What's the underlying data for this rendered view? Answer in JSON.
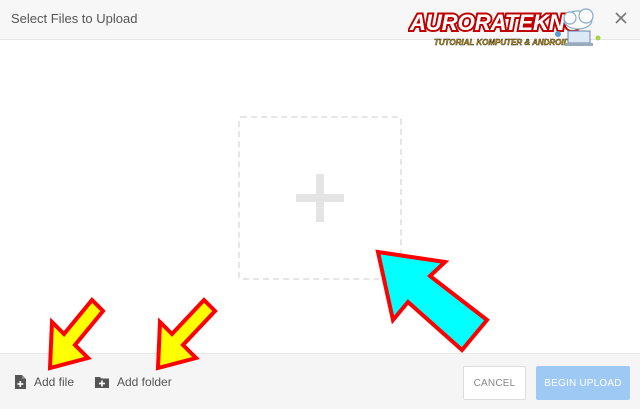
{
  "dialog": {
    "title": "Select Files to Upload"
  },
  "watermark": {
    "brand": "AURORATEKNO",
    "tagline": "TUTORIAL KOMPUTER & ANDROID"
  },
  "footer": {
    "add_file_label": "Add file",
    "add_folder_label": "Add folder",
    "cancel_label": "CANCEL",
    "begin_upload_label": "BEGIN UPLOAD"
  },
  "colors": {
    "primary_disabled": "#9ec9f5",
    "header_bg": "#f7f7f7",
    "footer_bg": "#f5f5f5",
    "annotation_yellow": "#ffff00",
    "annotation_cyan": "#00ffff",
    "annotation_red": "#ff0000"
  },
  "icons": {
    "close": "close-icon",
    "add_file": "file-plus-icon",
    "add_folder": "folder-plus-icon",
    "drop_zone": "plus-icon"
  }
}
